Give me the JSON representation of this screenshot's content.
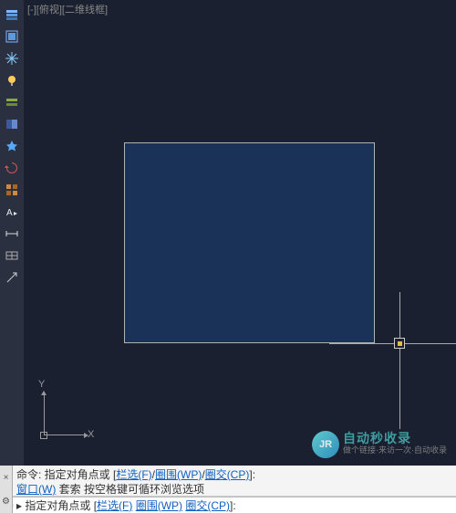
{
  "toolbar": {
    "icons": [
      {
        "name": "layer-properties-icon",
        "glyph": "▤",
        "color": "#7cb8ff"
      },
      {
        "name": "layer-states-icon",
        "glyph": "▥",
        "color": "#7cb8ff"
      },
      {
        "name": "layer-freeze-icon",
        "glyph": "❄",
        "color": "#88ccff"
      },
      {
        "name": "layer-off-icon",
        "glyph": "●",
        "color": "#ffcc55"
      },
      {
        "name": "layer-lock-icon",
        "glyph": "⊞",
        "color": "#88aa44"
      },
      {
        "name": "layer-isolate-icon",
        "glyph": "◧",
        "color": "#6688cc"
      },
      {
        "name": "layer-match-icon",
        "glyph": "✦",
        "color": "#55aaff"
      },
      {
        "name": "layer-previous-icon",
        "glyph": "↺",
        "color": "#cc5555"
      },
      {
        "name": "layer-walk-icon",
        "glyph": "▦",
        "color": "#cc8844"
      },
      {
        "name": "text-style-icon",
        "glyph": "A↲",
        "color": "#eeeeee"
      },
      {
        "name": "dimension-style-icon",
        "glyph": "⊢",
        "color": "#dddddd"
      },
      {
        "name": "table-style-icon",
        "glyph": "▭",
        "color": "#aaaaaa"
      },
      {
        "name": "annotation-scale-icon",
        "glyph": "↗",
        "color": "#cccccc"
      }
    ]
  },
  "viewport": {
    "label": "[-][俯视][二维线框]"
  },
  "ucs": {
    "x_label": "X",
    "y_label": "Y"
  },
  "command": {
    "history_line1_prefix": "命令: 指定对角点或 [",
    "opt_fence": "栏选(F)",
    "opt_wpoly": "圈围(WP)",
    "opt_cpoly": "圈交(CP)",
    "history_line1_suffix": "]:",
    "history_line2_prefix": "窗口(W)",
    "history_line2_rest": " 套索  按空格键可循环浏览选项",
    "input_prefix": "▸ 指定对角点或 [",
    "input_suffix": "]:",
    "close_x": "×",
    "customize": "⚙"
  },
  "watermark": {
    "brand": "自动秒收录",
    "sub": "做个链接·来访一次·自动收录",
    "logo": "JR"
  }
}
